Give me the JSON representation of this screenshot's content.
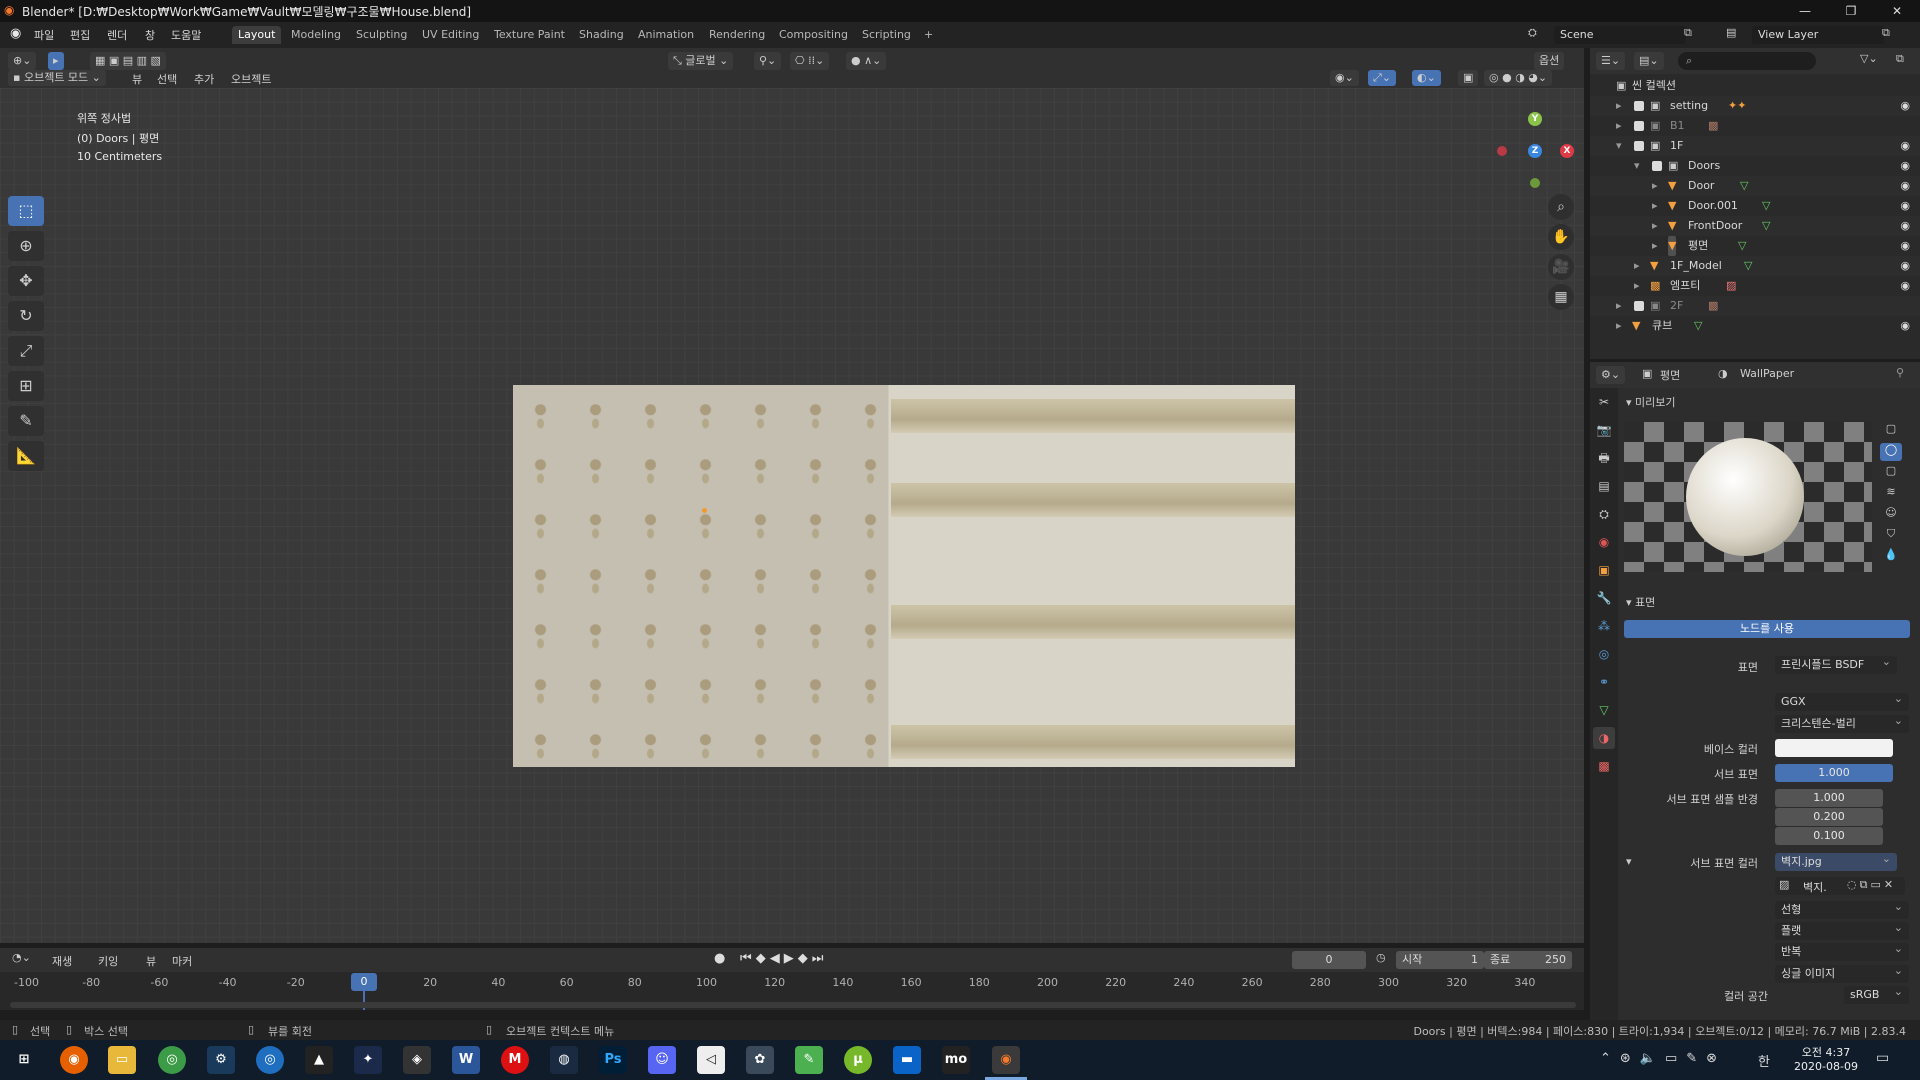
{
  "window": {
    "title": "Blender* [D:₩Desktop₩Work₩Game₩Vault₩모델링₩구조물₩House.blend]",
    "minimize": "—",
    "maximize": "❐",
    "close": "✕"
  },
  "menu": {
    "items": [
      "파일",
      "편집",
      "렌더",
      "창",
      "도움말"
    ]
  },
  "workspace_tabs": [
    "Layout",
    "Modeling",
    "Sculpting",
    "UV Editing",
    "Texture Paint",
    "Shading",
    "Animation",
    "Rendering",
    "Compositing",
    "Scripting",
    "+"
  ],
  "scene": {
    "name": "Scene",
    "view_layer": "View Layer"
  },
  "viewport": {
    "mode": "오브젝트 모드",
    "menus": [
      "뷰",
      "선택",
      "추가",
      "오브젝트"
    ],
    "orientation": "글로벌",
    "options": "옵션",
    "overlay_lines": [
      "위쪽 정사법",
      "(0) Doors | 평면",
      "10 Centimeters"
    ],
    "gizmo": {
      "y": "Y",
      "z": "Z",
      "x": "X"
    }
  },
  "timeline": {
    "menus": [
      "재생",
      "키잉",
      "뷰",
      "마커"
    ],
    "current_frame": "0",
    "start_label": "시작",
    "start": "1",
    "end_label": "종료",
    "end": "250",
    "ticks": [
      "-100",
      "-80",
      "-60",
      "-40",
      "-20",
      "0",
      "20",
      "40",
      "60",
      "80",
      "100",
      "120",
      "140",
      "160",
      "180",
      "200",
      "220",
      "240",
      "260",
      "280",
      "300",
      "320",
      "340"
    ],
    "playhead": "0"
  },
  "statusbar": {
    "select": "선택",
    "box_select": "박스 선택",
    "rotate_view": "뷰를 회전",
    "context_menu": "오브젝트 컨텍스트 메뉴",
    "stats": "Doors | 평면 | 버텍스:984 | 페이스:830 | 트라이:1,934 | 오브젝트:0/12 | 메모리: 76.7 MiB | 2.83.4"
  },
  "outliner": {
    "root": "씬 컬렉션",
    "rows": [
      {
        "label": "setting",
        "dim": false
      },
      {
        "label": "B1",
        "dim": true
      },
      {
        "label": "1F",
        "dim": false
      },
      {
        "label": "Doors",
        "dim": false
      },
      {
        "label": "Door",
        "dim": false
      },
      {
        "label": "Door.001",
        "dim": false
      },
      {
        "label": "FrontDoor",
        "dim": false
      },
      {
        "label": "평면",
        "dim": false
      },
      {
        "label": "1F_Model",
        "dim": false
      },
      {
        "label": "엠프티",
        "dim": false
      },
      {
        "label": "2F",
        "dim": true
      },
      {
        "label": "큐브",
        "dim": false
      }
    ]
  },
  "properties": {
    "object": "평면",
    "material": "WallPaper",
    "preview_panel": "미리보기",
    "surface_panel": "표면",
    "use_nodes": "노드를 사용",
    "surface_label": "표면",
    "surface_value": "프린시플드 BSDF",
    "distribution": "GGX",
    "subsurface_method": "크리스텐슨-벌리",
    "base_color_label": "베이스 컬러",
    "subsurface_label": "서브 표면",
    "subsurface_value": "1.000",
    "radius_label": "서브 표면 샘플 반경",
    "radius_values": [
      "1.000",
      "0.200",
      "0.100"
    ],
    "subsurface_color_label": "서브 표면 컬러",
    "subsurface_color_value": "벽지.jpg",
    "image_name": "벽지.",
    "interpolation": "선형",
    "projection": "플랫",
    "extension": "반복",
    "source": "싱글 이미지",
    "colorspace_label": "컬러 공간",
    "colorspace_value": "sRGB"
  },
  "taskbar": {
    "time": "오전 4:37",
    "date": "2020-08-09",
    "apps": [
      "Ps",
      "W",
      "M",
      "mo"
    ]
  },
  "colors": {
    "accent": "#4772b3",
    "bg": "#393939",
    "panel": "#2d2d2d"
  }
}
